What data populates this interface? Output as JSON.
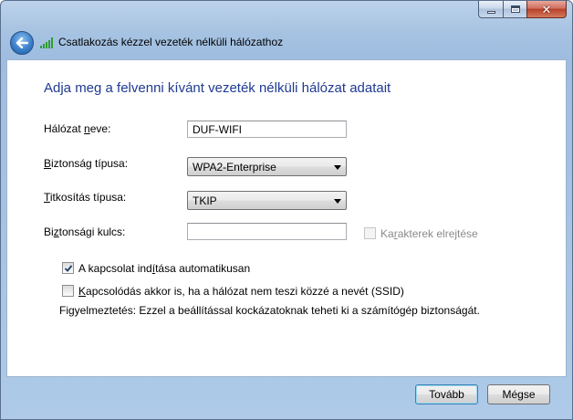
{
  "window": {
    "controls": [
      "minimize-icon",
      "maximize-icon",
      "close-icon"
    ]
  },
  "nav": {
    "back_icon": "back-arrow-icon",
    "wifi_icon": "wireless-signal-icon",
    "title": "Csatlakozás kézzel vezeték nélküli hálózathoz"
  },
  "main": {
    "heading": "Adja meg a felvenni kívánt vezeték nélküli hálózat adatait",
    "network_name": {
      "label_pre": "Hálózat ",
      "label_key": "n",
      "label_post": "eve:",
      "value": "DUF-WIFI"
    },
    "security_type": {
      "label_key": "B",
      "label_post": "iztonság típusa:",
      "value": "WPA2-Enterprise"
    },
    "encryption_type": {
      "label_key": "T",
      "label_post": "itkosítás típusa:",
      "value": "TKIP"
    },
    "security_key": {
      "label_pre": "Bi",
      "label_key": "z",
      "label_post": "tonsági kulcs:",
      "value": ""
    },
    "hide_chars": {
      "label_pre": "Ka",
      "label_key": "r",
      "label_post": "akterek elrejtése",
      "checked": false,
      "disabled": true
    },
    "auto_start": {
      "label_pre": "A kapcsolat ind",
      "label_key": "í",
      "label_post": "tása automatikusan",
      "checked": true
    },
    "connect_hidden": {
      "label_key": "K",
      "label_post": "apcsolódás akkor is, ha a hálózat nem teszi közzé a nevét (SSID)",
      "checked": false
    },
    "warning": "Figyelmeztetés: Ezzel a beállítással kockázatoknak teheti ki a számítógép biztonságát."
  },
  "footer": {
    "next_label": "Tovább",
    "cancel_label": "Mégse"
  },
  "colors": {
    "heading": "#1f3a93",
    "frame": "#a9c4e2"
  }
}
